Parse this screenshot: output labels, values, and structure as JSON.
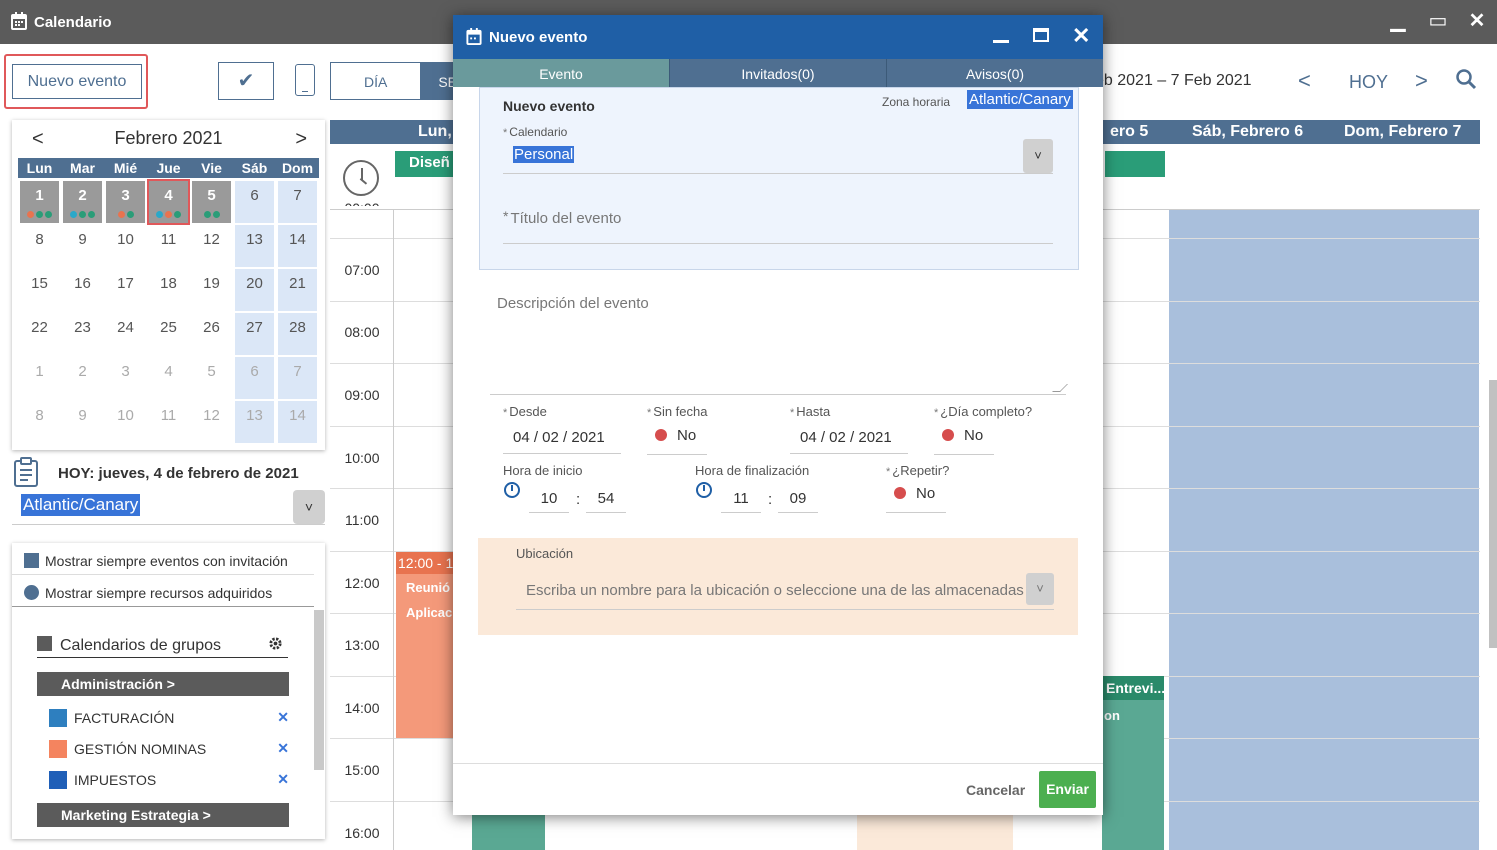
{
  "window": {
    "title": "Calendario",
    "minimize": "▁",
    "maximize": "▭",
    "close": "✕"
  },
  "toolbar": {
    "new_event": "Nuevo evento",
    "check": "✔",
    "views": [
      "DÍA",
      "SE"
    ],
    "range": "eb 2021 – 7 Feb 2021",
    "prev": "<",
    "today": "HOY",
    "next": ">",
    "search_icon": "search-icon"
  },
  "mini_calendar": {
    "month": "Febrero 2021",
    "prev": "<",
    "next": ">",
    "weekdays": [
      "Lun",
      "Mar",
      "Mié",
      "Jue",
      "Vie",
      "Sáb",
      "Dom"
    ],
    "weeks": [
      [
        "1",
        "2",
        "3",
        "4",
        "5",
        "6",
        "7"
      ],
      [
        "8",
        "9",
        "10",
        "11",
        "12",
        "13",
        "14"
      ],
      [
        "15",
        "16",
        "17",
        "18",
        "19",
        "20",
        "21"
      ],
      [
        "22",
        "23",
        "24",
        "25",
        "26",
        "27",
        "28"
      ],
      [
        "1",
        "2",
        "3",
        "4",
        "5",
        "6",
        "7"
      ],
      [
        "8",
        "9",
        "10",
        "11",
        "12",
        "13",
        "14"
      ]
    ],
    "today_text": "HOY: jueves, 4 de febrero de 2021",
    "timezone": "Atlantic/Canary"
  },
  "left_panel": {
    "show_invitations": "Mostrar siempre eventos con invitación",
    "show_resources": "Mostrar siempre recursos adquiridos",
    "group_calendars": "Calendarios de grupos",
    "groups": [
      {
        "name": "Administración >",
        "items": [
          {
            "label": "FACTURACIÓN",
            "color": "#2e7fbf"
          },
          {
            "label": "GESTIÓN NOMINAS",
            "color": "#f4845f"
          },
          {
            "label": "IMPUESTOS",
            "color": "#1f5fb8"
          }
        ]
      },
      {
        "name": "Marketing Estrategia >",
        "items": []
      }
    ],
    "remove": "✕"
  },
  "calendar": {
    "headers": [
      "Lun, ",
      "ero 5",
      "Sáb, Febrero 6",
      "Dom, Febrero 7"
    ],
    "top_partial": "00:00",
    "hours": [
      "07:00",
      "08:00",
      "09:00",
      "10:00",
      "11:00",
      "12:00",
      "13:00",
      "14:00",
      "15:00",
      "16:00"
    ],
    "events": {
      "design": "Diseñ",
      "orange_time": "12:00 - 1",
      "orange_l1": "Reunió",
      "orange_l2": "Aplicac",
      "teal_title": "Entrevi...",
      "teal_sub": "on"
    }
  },
  "modal": {
    "title": "Nuevo evento",
    "tabs": [
      "Evento",
      "Invitados(0)",
      "Avisos(0)"
    ],
    "section_title": "Nuevo evento",
    "tz_label": "Zona horaria",
    "tz_value": "Atlantic/Canary",
    "calendar_label": "Calendario",
    "calendar_value": "Personal",
    "event_title_placeholder": "Título del evento",
    "description_placeholder": "Descripción del evento",
    "from_label": "Desde",
    "from_value": "04 / 02 / 2021",
    "nodate_label": "Sin fecha",
    "nodate_value": "No",
    "to_label": "Hasta",
    "to_value": "04 / 02 / 2021",
    "allday_label": "¿Día completo?",
    "allday_value": "No",
    "start_label": "Hora de inicio",
    "start_h": "10",
    "start_m": "54",
    "end_label": "Hora de finalización",
    "end_h": "11",
    "end_m": "09",
    "repeat_label": "¿Repetir?",
    "repeat_value": "No",
    "location_label": "Ubicación",
    "location_placeholder": "Escriba un nombre para la ubicación o seleccione una de las almacenadas",
    "cancel": "Cancelar",
    "send": "Enviar",
    "req": "*",
    "colon": ":"
  }
}
